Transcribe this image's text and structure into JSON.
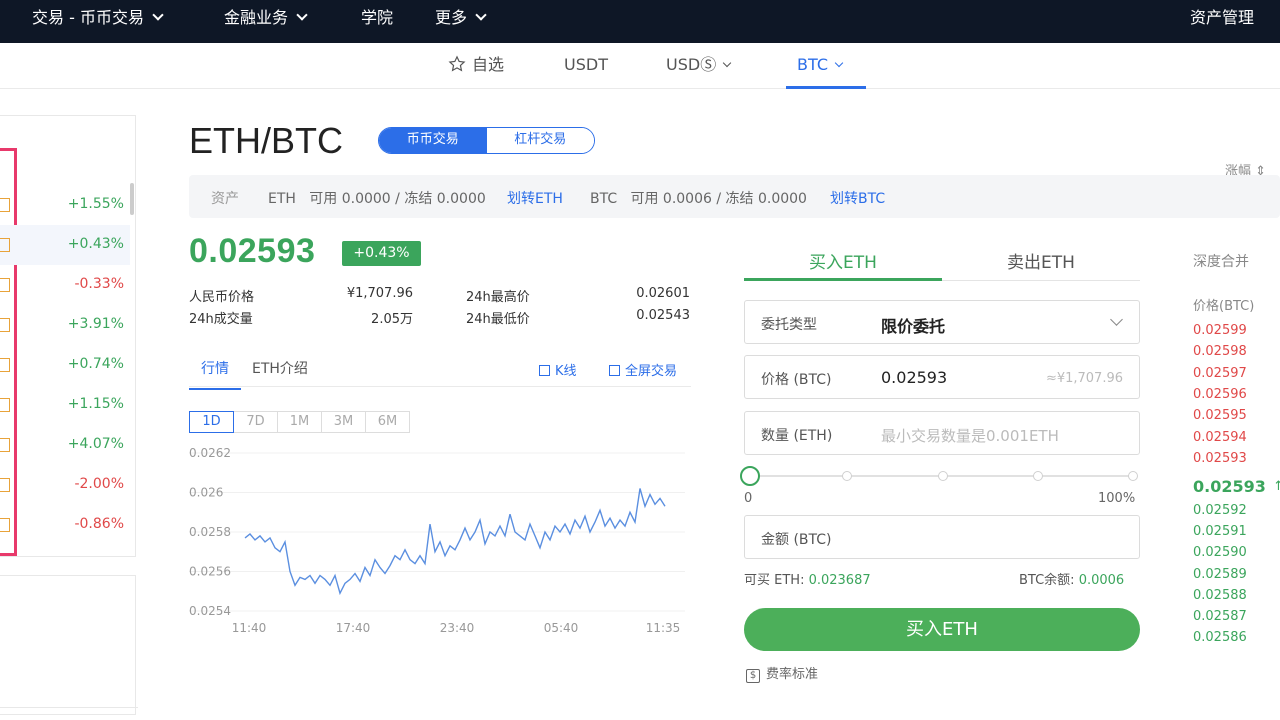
{
  "nav": {
    "items": [
      {
        "label": "交易 - 币币交易",
        "dropdown": true
      },
      {
        "label": "金融业务",
        "dropdown": true
      },
      {
        "label": "学院",
        "dropdown": false
      },
      {
        "label": "更多",
        "dropdown": true
      }
    ],
    "right": "资产管理"
  },
  "market_tabs": {
    "favorites": "自选",
    "usdt": "USDT",
    "usds": "USDⓈ",
    "btc": "BTC",
    "active": "BTC"
  },
  "left_list": {
    "header": "涨幅 ⇕",
    "changes": [
      "+1.55%",
      "+0.43%",
      "-0.33%",
      "+3.91%",
      "+0.74%",
      "+1.15%",
      "+4.07%",
      "-2.00%",
      "-0.86%"
    ]
  },
  "pair": {
    "title": "ETH/BTC",
    "mode_spot": "币币交易",
    "mode_margin": "杠杆交易"
  },
  "assets": {
    "label": "资产",
    "eth": "ETH   可用 0.0000 / 冻结 0.0000",
    "eth_transfer": "划转ETH",
    "btc": "BTC   可用 0.0006 / 冻结 0.0000",
    "btc_transfer": "划转BTC"
  },
  "ticker": {
    "price": "0.02593",
    "change": "+0.43%",
    "cny_label": "人民币价格",
    "cny_value": "¥1,707.96",
    "vol_label": "24h成交量",
    "vol_value": "2.05万",
    "high_label": "24h最高价",
    "high_value": "0.02601",
    "low_label": "24h最低价",
    "low_value": "0.02543"
  },
  "chart_tabs": {
    "market": "行情",
    "intro": "ETH介绍",
    "kline": "K线",
    "fullscreen": "全屏交易"
  },
  "ranges": [
    "1D",
    "7D",
    "1M",
    "3M",
    "6M"
  ],
  "chart_data": {
    "type": "line",
    "x_ticks": [
      "11:40",
      "17:40",
      "23:40",
      "05:40",
      "11:35"
    ],
    "y_ticks": [
      "0.0262",
      "0.026",
      "0.0258",
      "0.0256",
      "0.0254"
    ],
    "ylim": [
      0.0254,
      0.0262
    ],
    "color": "#5b8fe0",
    "values": [
      0.02577,
      0.02579,
      0.02576,
      0.02578,
      0.02575,
      0.02577,
      0.02572,
      0.0257,
      0.02575,
      0.0256,
      0.02553,
      0.02557,
      0.02556,
      0.02558,
      0.02554,
      0.02558,
      0.02556,
      0.02553,
      0.02558,
      0.02549,
      0.02554,
      0.02556,
      0.02559,
      0.02555,
      0.02562,
      0.02558,
      0.02566,
      0.02562,
      0.02559,
      0.02563,
      0.02568,
      0.02566,
      0.02571,
      0.02566,
      0.02564,
      0.02568,
      0.02564,
      0.02584,
      0.0257,
      0.02575,
      0.02568,
      0.02573,
      0.02571,
      0.02576,
      0.02582,
      0.02576,
      0.0258,
      0.02586,
      0.02574,
      0.0258,
      0.02578,
      0.02583,
      0.02578,
      0.02589,
      0.0258,
      0.02578,
      0.02576,
      0.02584,
      0.02578,
      0.02572,
      0.0258,
      0.02576,
      0.02583,
      0.0258,
      0.02584,
      0.02579,
      0.02586,
      0.02582,
      0.02588,
      0.0258,
      0.02585,
      0.02591,
      0.02583,
      0.02587,
      0.02582,
      0.02586,
      0.02583,
      0.0259,
      0.02585,
      0.02602,
      0.02593,
      0.02599,
      0.02594,
      0.02597,
      0.02593
    ]
  },
  "order": {
    "buy_tab": "买入ETH",
    "sell_tab": "卖出ETH",
    "type_label": "委托类型",
    "type_value": "限价委托",
    "price_label": "价格 (BTC)",
    "price_value": "0.02593",
    "price_hint": "≈¥1,707.96",
    "qty_label": "数量 (ETH)",
    "qty_placeholder": "最小交易数量是0.001ETH",
    "slider_min": "0",
    "slider_max": "100%",
    "slider_level": 0,
    "amount_label": "金额 (BTC)",
    "can_buy_label": "可买 ETH: ",
    "can_buy_value": "0.023687",
    "balance_label": "BTC余额: ",
    "balance_value": "0.0006",
    "buy_button": "买入ETH",
    "fee_link": "费率标准"
  },
  "depth": {
    "title": "深度合并",
    "header": "价格(BTC)",
    "asks": [
      "0.02599",
      "0.02598",
      "0.02597",
      "0.02596",
      "0.02595",
      "0.02594",
      "0.02593"
    ],
    "last": "0.02593",
    "bids": [
      "0.02592",
      "0.02591",
      "0.02590",
      "0.02589",
      "0.02588",
      "0.02587",
      "0.02586"
    ]
  },
  "colors": {
    "up": "#3ba55c",
    "down": "#e04848",
    "accent": "#2c6ee8",
    "nav_bg": "#0e1726"
  }
}
